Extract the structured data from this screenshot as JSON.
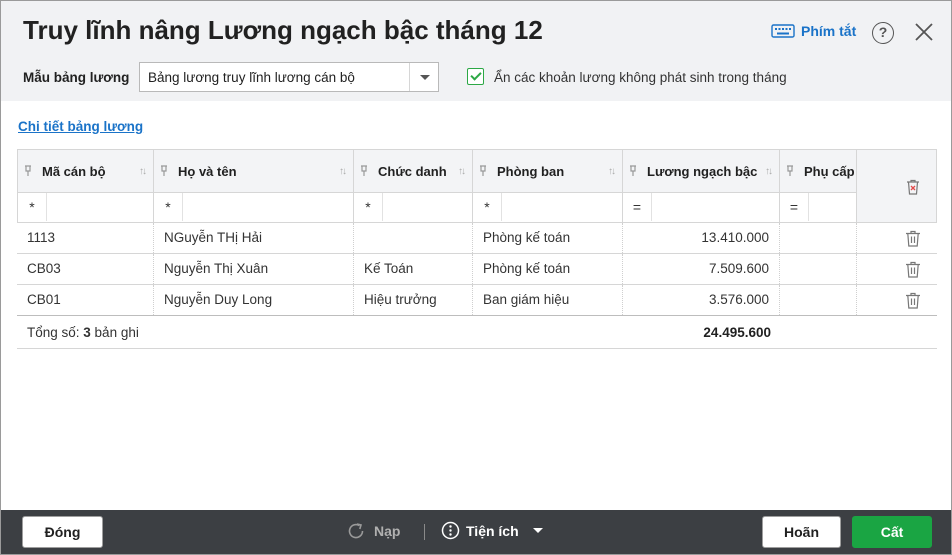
{
  "window": {
    "title": "Truy lĩnh nâng Lương ngạch bậc tháng 12",
    "shortcut_label": "Phím tắt",
    "help_label": "?"
  },
  "filters": {
    "template_label": "Mẫu bảng lương",
    "template_value": "Bảng lương truy lĩnh lương cán bộ",
    "hide_checkbox_label": "Ẩn các khoản lương không phát sinh trong tháng",
    "hide_checked": true
  },
  "detail_link": "Chi tiết bảng lương",
  "table": {
    "columns": [
      {
        "label": "Mã cán bộ",
        "filter_op": "*"
      },
      {
        "label": "Họ và tên",
        "filter_op": "*"
      },
      {
        "label": "Chức danh",
        "filter_op": "*"
      },
      {
        "label": "Phòng ban",
        "filter_op": "*"
      },
      {
        "label": "Lương ngạch bậc",
        "filter_op": "="
      },
      {
        "label": "Phụ cấp",
        "filter_op": "="
      }
    ],
    "rows": [
      {
        "code": "1113",
        "name": "NGuyễn THị Hải",
        "title": "",
        "dept": "Phòng kế toán",
        "salary": "13.410.000",
        "allowance": ""
      },
      {
        "code": "CB03",
        "name": "Nguyễn Thị Xuân",
        "title": "Kế Toán",
        "dept": "Phòng kế toán",
        "salary": "7.509.600",
        "allowance": ""
      },
      {
        "code": "CB01",
        "name": "Nguyễn Duy Long",
        "title": "Hiệu trưởng",
        "dept": "Ban giám hiệu",
        "salary": "3.576.000",
        "allowance": ""
      }
    ],
    "footer": {
      "total_prefix": "Tổng số: ",
      "total_count": "3",
      "total_suffix": " bản ghi",
      "salary_sum": "24.495.600"
    }
  },
  "bottombar": {
    "close_label": "Đóng",
    "reload_label": "Nạp",
    "utilities_label": "Tiện ích",
    "cancel_label": "Hoãn",
    "save_label": "Cất"
  },
  "colors": {
    "accent_green": "#1aa543",
    "link_blue": "#1a73c8",
    "bottombar": "#3c3f43"
  }
}
